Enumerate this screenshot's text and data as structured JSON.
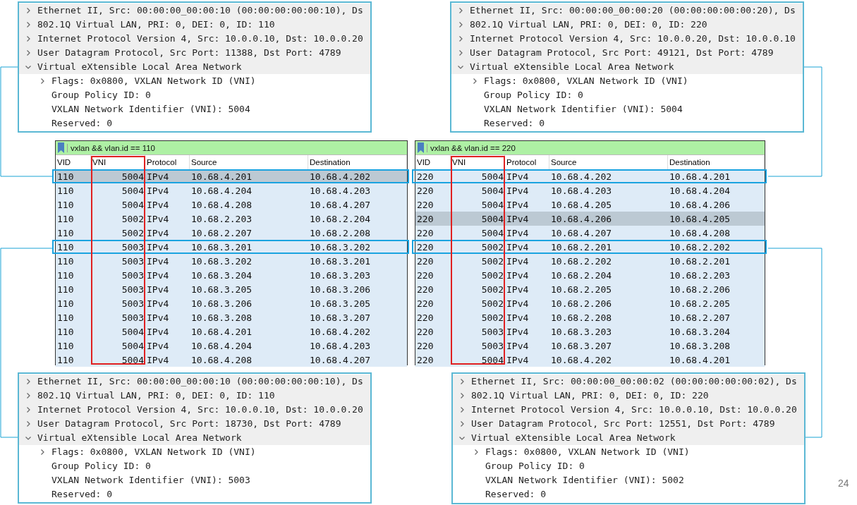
{
  "detail_panels": [
    {
      "items": [
        {
          "kind": "node",
          "text": "Ethernet II, Src: 00:00:00_00:00:10 (00:00:00:00:00:10), Ds",
          "expanded": false
        },
        {
          "kind": "node",
          "text": "802.1Q Virtual LAN, PRI: 0, DEI: 0, ID: 110",
          "expanded": false
        },
        {
          "kind": "node",
          "text": "Internet Protocol Version 4, Src: 10.0.0.10, Dst: 10.0.0.20",
          "expanded": false
        },
        {
          "kind": "node",
          "text": "User Datagram Protocol, Src Port: 11388, Dst Port: 4789",
          "expanded": false
        },
        {
          "kind": "node",
          "text": "Virtual eXtensible Local Area Network",
          "expanded": true,
          "children": [
            {
              "kind": "node",
              "text": "Flags: 0x0800, VXLAN Network ID (VNI)",
              "expanded": false
            },
            {
              "kind": "field",
              "text": "Group Policy ID: 0"
            },
            {
              "kind": "field",
              "text": "VXLAN Network Identifier (VNI): 5004"
            },
            {
              "kind": "field",
              "text": "Reserved: 0"
            }
          ]
        }
      ]
    },
    {
      "items": [
        {
          "kind": "node",
          "text": "Ethernet II, Src: 00:00:00_00:00:20 (00:00:00:00:00:20), Ds",
          "expanded": false
        },
        {
          "kind": "node",
          "text": "802.1Q Virtual LAN, PRI: 0, DEI: 0, ID: 220",
          "expanded": false
        },
        {
          "kind": "node",
          "text": "Internet Protocol Version 4, Src: 10.0.0.20, Dst: 10.0.0.10",
          "expanded": false
        },
        {
          "kind": "node",
          "text": "User Datagram Protocol, Src Port: 49121, Dst Port: 4789",
          "expanded": false
        },
        {
          "kind": "node",
          "text": "Virtual eXtensible Local Area Network",
          "expanded": true,
          "children": [
            {
              "kind": "node",
              "text": "Flags: 0x0800, VXLAN Network ID (VNI)",
              "expanded": false
            },
            {
              "kind": "field",
              "text": "Group Policy ID: 0"
            },
            {
              "kind": "field",
              "text": "VXLAN Network Identifier (VNI): 5004"
            },
            {
              "kind": "field",
              "text": "Reserved: 0"
            }
          ]
        }
      ]
    },
    {
      "items": [
        {
          "kind": "node",
          "text": "Ethernet II, Src: 00:00:00_00:00:10 (00:00:00:00:00:10), Ds",
          "expanded": false
        },
        {
          "kind": "node",
          "text": "802.1Q Virtual LAN, PRI: 0, DEI: 0, ID: 110",
          "expanded": false
        },
        {
          "kind": "node",
          "text": "Internet Protocol Version 4, Src: 10.0.0.10, Dst: 10.0.0.20",
          "expanded": false
        },
        {
          "kind": "node",
          "text": "User Datagram Protocol, Src Port: 18730, Dst Port: 4789",
          "expanded": false
        },
        {
          "kind": "node",
          "text": "Virtual eXtensible Local Area Network",
          "expanded": true,
          "children": [
            {
              "kind": "node",
              "text": "Flags: 0x0800, VXLAN Network ID (VNI)",
              "expanded": false
            },
            {
              "kind": "field",
              "text": "Group Policy ID: 0"
            },
            {
              "kind": "field",
              "text": "VXLAN Network Identifier (VNI): 5003"
            },
            {
              "kind": "field",
              "text": "Reserved: 0"
            }
          ]
        }
      ]
    },
    {
      "items": [
        {
          "kind": "node",
          "text": "Ethernet II, Src: 00:00:00_00:00:02 (00:00:00:00:00:02), Ds",
          "expanded": false
        },
        {
          "kind": "node",
          "text": "802.1Q Virtual LAN, PRI: 0, DEI: 0, ID: 220",
          "expanded": false
        },
        {
          "kind": "node",
          "text": "Internet Protocol Version 4, Src: 10.0.0.10, Dst: 10.0.0.20",
          "expanded": false
        },
        {
          "kind": "node",
          "text": "User Datagram Protocol, Src Port: 12551, Dst Port: 4789",
          "expanded": false
        },
        {
          "kind": "node",
          "text": "Virtual eXtensible Local Area Network",
          "expanded": true,
          "children": [
            {
              "kind": "node",
              "text": "Flags: 0x0800, VXLAN Network ID (VNI)",
              "expanded": false
            },
            {
              "kind": "field",
              "text": "Group Policy ID: 0"
            },
            {
              "kind": "field",
              "text": "VXLAN Network Identifier (VNI): 5002"
            },
            {
              "kind": "field",
              "text": "Reserved: 0"
            }
          ]
        }
      ]
    }
  ],
  "packet_lists": [
    {
      "filter": "vxlan && vlan.id == 110",
      "columns": [
        "VID",
        "VNI",
        "Protocol",
        "Source",
        "Destination"
      ],
      "rows": [
        {
          "cells": [
            "110",
            "5004",
            "IPv4",
            "10.68.4.201",
            "10.68.4.202"
          ],
          "selected": true,
          "outlined": true
        },
        {
          "cells": [
            "110",
            "5004",
            "IPv4",
            "10.68.4.204",
            "10.68.4.203"
          ],
          "selected": false,
          "outlined": false
        },
        {
          "cells": [
            "110",
            "5004",
            "IPv4",
            "10.68.4.208",
            "10.68.4.207"
          ],
          "selected": false,
          "outlined": false
        },
        {
          "cells": [
            "110",
            "5002",
            "IPv4",
            "10.68.2.203",
            "10.68.2.204"
          ],
          "selected": false,
          "outlined": false
        },
        {
          "cells": [
            "110",
            "5002",
            "IPv4",
            "10.68.2.207",
            "10.68.2.208"
          ],
          "selected": false,
          "outlined": false
        },
        {
          "cells": [
            "110",
            "5003",
            "IPv4",
            "10.68.3.201",
            "10.68.3.202"
          ],
          "selected": false,
          "outlined": true
        },
        {
          "cells": [
            "110",
            "5003",
            "IPv4",
            "10.68.3.202",
            "10.68.3.201"
          ],
          "selected": false,
          "outlined": false
        },
        {
          "cells": [
            "110",
            "5003",
            "IPv4",
            "10.68.3.204",
            "10.68.3.203"
          ],
          "selected": false,
          "outlined": false
        },
        {
          "cells": [
            "110",
            "5003",
            "IPv4",
            "10.68.3.205",
            "10.68.3.206"
          ],
          "selected": false,
          "outlined": false
        },
        {
          "cells": [
            "110",
            "5003",
            "IPv4",
            "10.68.3.206",
            "10.68.3.205"
          ],
          "selected": false,
          "outlined": false
        },
        {
          "cells": [
            "110",
            "5003",
            "IPv4",
            "10.68.3.208",
            "10.68.3.207"
          ],
          "selected": false,
          "outlined": false
        },
        {
          "cells": [
            "110",
            "5004",
            "IPv4",
            "10.68.4.201",
            "10.68.4.202"
          ],
          "selected": false,
          "outlined": false
        },
        {
          "cells": [
            "110",
            "5004",
            "IPv4",
            "10.68.4.204",
            "10.68.4.203"
          ],
          "selected": false,
          "outlined": false
        },
        {
          "cells": [
            "110",
            "5004",
            "IPv4",
            "10.68.4.208",
            "10.68.4.207"
          ],
          "selected": false,
          "outlined": false
        }
      ]
    },
    {
      "filter": "vxlan && vlan.id == 220",
      "columns": [
        "VID",
        "VNI",
        "Protocol",
        "Source",
        "Destination"
      ],
      "rows": [
        {
          "cells": [
            "220",
            "5004",
            "IPv4",
            "10.68.4.202",
            "10.68.4.201"
          ],
          "selected": false,
          "outlined": true
        },
        {
          "cells": [
            "220",
            "5004",
            "IPv4",
            "10.68.4.203",
            "10.68.4.204"
          ],
          "selected": false,
          "outlined": false
        },
        {
          "cells": [
            "220",
            "5004",
            "IPv4",
            "10.68.4.205",
            "10.68.4.206"
          ],
          "selected": false,
          "outlined": false
        },
        {
          "cells": [
            "220",
            "5004",
            "IPv4",
            "10.68.4.206",
            "10.68.4.205"
          ],
          "selected": true,
          "outlined": false
        },
        {
          "cells": [
            "220",
            "5004",
            "IPv4",
            "10.68.4.207",
            "10.68.4.208"
          ],
          "selected": false,
          "outlined": false
        },
        {
          "cells": [
            "220",
            "5002",
            "IPv4",
            "10.68.2.201",
            "10.68.2.202"
          ],
          "selected": false,
          "outlined": true
        },
        {
          "cells": [
            "220",
            "5002",
            "IPv4",
            "10.68.2.202",
            "10.68.2.201"
          ],
          "selected": false,
          "outlined": false
        },
        {
          "cells": [
            "220",
            "5002",
            "IPv4",
            "10.68.2.204",
            "10.68.2.203"
          ],
          "selected": false,
          "outlined": false
        },
        {
          "cells": [
            "220",
            "5002",
            "IPv4",
            "10.68.2.205",
            "10.68.2.206"
          ],
          "selected": false,
          "outlined": false
        },
        {
          "cells": [
            "220",
            "5002",
            "IPv4",
            "10.68.2.206",
            "10.68.2.205"
          ],
          "selected": false,
          "outlined": false
        },
        {
          "cells": [
            "220",
            "5002",
            "IPv4",
            "10.68.2.208",
            "10.68.2.207"
          ],
          "selected": false,
          "outlined": false
        },
        {
          "cells": [
            "220",
            "5003",
            "IPv4",
            "10.68.3.203",
            "10.68.3.204"
          ],
          "selected": false,
          "outlined": false
        },
        {
          "cells": [
            "220",
            "5003",
            "IPv4",
            "10.68.3.207",
            "10.68.3.208"
          ],
          "selected": false,
          "outlined": false
        },
        {
          "cells": [
            "220",
            "5004",
            "IPv4",
            "10.68.4.202",
            "10.68.4.201"
          ],
          "selected": false,
          "outlined": false
        }
      ]
    }
  ],
  "page_number": "24"
}
